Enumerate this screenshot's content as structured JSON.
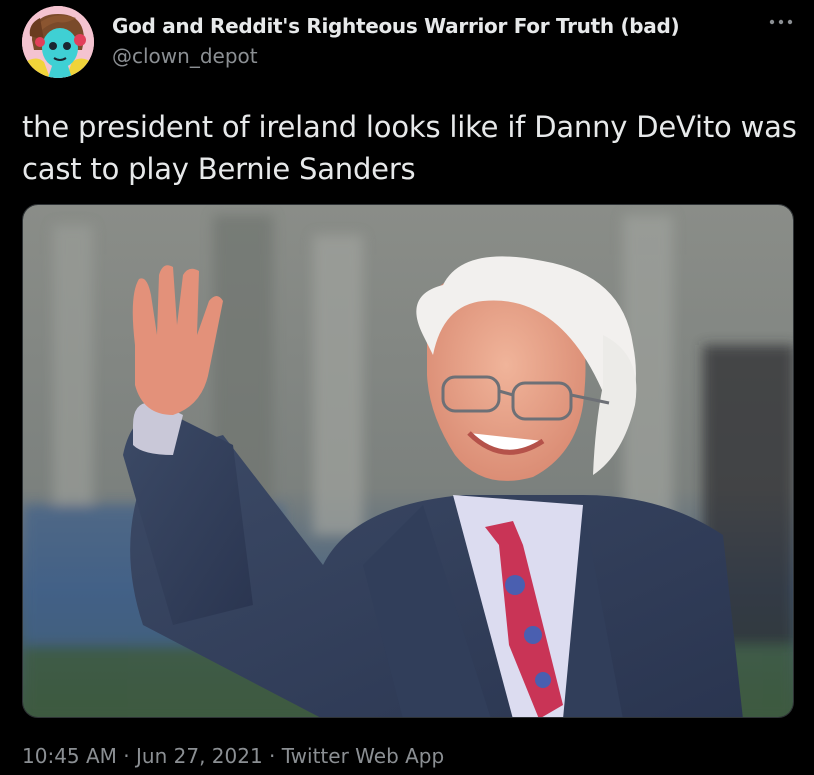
{
  "author": {
    "display_name": "God and Reddit's Righteous Warrior For Truth (bad)",
    "handle": "@clown_depot"
  },
  "icons": {
    "more": "more-horizontal-icon",
    "avatar": "avatar-image"
  },
  "tweet": {
    "text": "the president of ireland looks like if Danny DeVito was cast to play Bernie Sanders"
  },
  "media": {
    "alt": "photo of a smiling white-haired man in glasses and a tweed suit waving"
  },
  "meta": {
    "time": "10:45 AM",
    "separator1": " · ",
    "date": "Jun 27, 2021",
    "separator2": " · ",
    "source": "Twitter Web App"
  },
  "colors": {
    "background": "#000000",
    "primary_text": "#e7e9ea",
    "secondary_text": "#8b8f93"
  }
}
